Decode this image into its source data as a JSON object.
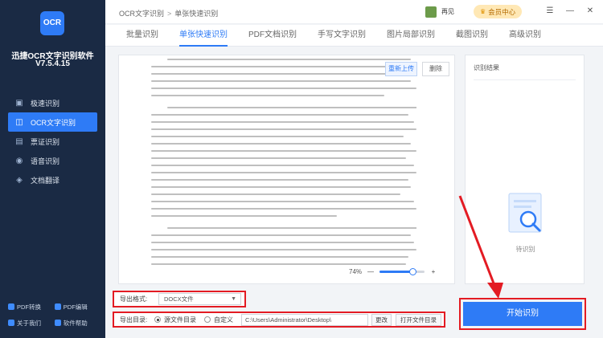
{
  "sidebar": {
    "logo_text": "OCR",
    "app_name": "迅捷OCR文字识别软件",
    "version": "V7.5.4.15",
    "nav": [
      {
        "label": "极速识别",
        "icon": "image-icon",
        "glyph": "▣"
      },
      {
        "label": "OCR文字识别",
        "icon": "ocr-icon",
        "glyph": "◫"
      },
      {
        "label": "票证识别",
        "icon": "ticket-icon",
        "glyph": "▤"
      },
      {
        "label": "语音识别",
        "icon": "microphone-icon",
        "glyph": "◉"
      },
      {
        "label": "文档翻译",
        "icon": "translate-icon",
        "glyph": "◈"
      }
    ],
    "links": [
      {
        "label": "PDF转换",
        "icon": "pdf-convert-icon"
      },
      {
        "label": "PDF编辑",
        "icon": "pdf-edit-icon"
      },
      {
        "label": "关于我们",
        "icon": "about-icon"
      },
      {
        "label": "软件帮助",
        "icon": "help-icon"
      }
    ]
  },
  "topbar": {
    "breadcrumb_root": "OCR文字识别",
    "breadcrumb_separator": ">",
    "breadcrumb_current": "单张快速识别",
    "username": "再见",
    "vip_label": "会员中心",
    "window_controls": [
      "☰",
      "—",
      "✕"
    ]
  },
  "tabs": [
    "批量识别",
    "单张快速识别",
    "PDF文档识别",
    "手写文字识别",
    "图片局部识别",
    "截图识别",
    "高级识别"
  ],
  "active_tab_index": 1,
  "preview": {
    "reupload_label": "重新上传",
    "delete_label": "删除",
    "zoom_text": "74%",
    "zoom_minus": "—",
    "zoom_plus": "+",
    "zoom_value": 0.74
  },
  "result": {
    "title": "识别结果",
    "empty_label": "待识别"
  },
  "export": {
    "format_label": "导出格式:",
    "format_value": "DOCX文件",
    "dir_label": "导出目录:",
    "radio_source": "源文件目录",
    "radio_custom": "自定义",
    "path_value": "C:\\Users\\Administrator\\Desktop\\",
    "change_label": "更改",
    "open_label": "打开文件目录"
  },
  "start_label": "开始识别",
  "colors": {
    "accent": "#2e7bf6",
    "sidebar_bg": "#1a2a44",
    "highlight_red": "#e31b23"
  }
}
